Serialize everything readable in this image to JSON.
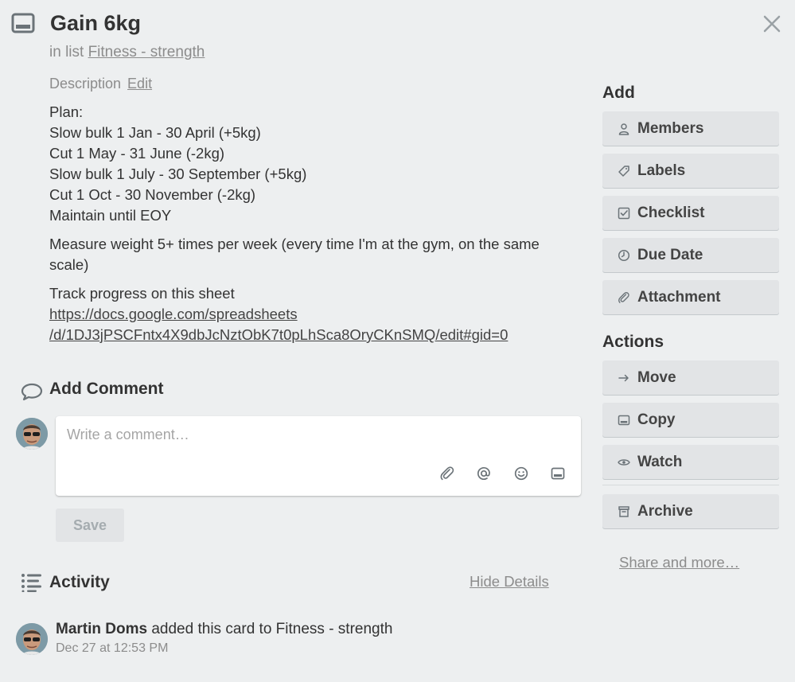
{
  "card": {
    "title": "Gain 6kg",
    "in_list_prefix": "in list",
    "list_name": "Fitness - strength"
  },
  "description": {
    "label": "Description",
    "edit_label": "Edit",
    "lines": [
      "Plan:",
      "Slow bulk 1 Jan - 30 April (+5kg)",
      "Cut 1 May - 31 June (-2kg)",
      "Slow bulk 1 July - 30 September (+5kg)",
      "Cut 1 Oct - 30 November (-2kg)",
      "Maintain until EOY"
    ],
    "measure_text": "Measure weight 5+ times per week (every time I'm at the gym, on the same scale)",
    "track_text": "Track progress on this sheet",
    "link_line1": "https://docs.google.com/spreadsheets",
    "link_line2": "/d/1DJ3jPSCFntx4X9dbJcNztObK7t0pLhSca8OryCKnSMQ/edit#gid=0"
  },
  "comment": {
    "title": "Add Comment",
    "placeholder": "Write a comment…",
    "save_label": "Save",
    "toolbar_icons": [
      "attachment-icon",
      "mention-icon",
      "emoji-icon",
      "card-icon"
    ]
  },
  "activity": {
    "title": "Activity",
    "hide_details_label": "Hide Details",
    "entries": [
      {
        "user": "Martin Doms",
        "action": "added this card to Fitness - strength",
        "time": "Dec 27 at 12:53 PM"
      }
    ]
  },
  "sidebar": {
    "add_title": "Add",
    "add_buttons": [
      {
        "label": "Members",
        "icon": "person-icon"
      },
      {
        "label": "Labels",
        "icon": "tag-icon"
      },
      {
        "label": "Checklist",
        "icon": "checkbox-icon"
      },
      {
        "label": "Due Date",
        "icon": "clock-icon"
      },
      {
        "label": "Attachment",
        "icon": "paperclip-icon"
      }
    ],
    "actions_title": "Actions",
    "action_buttons": [
      {
        "label": "Move",
        "icon": "arrow-right-icon"
      },
      {
        "label": "Copy",
        "icon": "card-icon"
      },
      {
        "label": "Watch",
        "icon": "eye-icon"
      },
      {
        "label": "Archive",
        "icon": "archive-icon"
      }
    ],
    "share_more_label": "Share and more…"
  },
  "colors": {
    "background": "#edeff0",
    "button_bg": "#e2e4e6",
    "muted_text": "#8c8c8c",
    "text": "#333333"
  }
}
